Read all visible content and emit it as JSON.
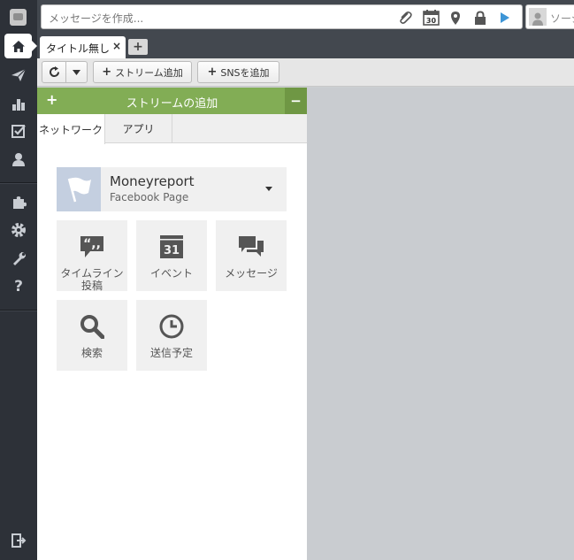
{
  "compose": {
    "placeholder": "メッセージを作成...",
    "calendar_day": "30",
    "icons": [
      "paperclip-icon",
      "calendar-icon",
      "location-pin-icon",
      "lock-icon",
      "send-arrow-icon"
    ]
  },
  "profile_selector": {
    "text": "ソーシ"
  },
  "sidebar": {
    "items": [
      {
        "name": "home-icon",
        "active": true
      },
      {
        "name": "send-icon"
      },
      {
        "name": "analytics-icon"
      },
      {
        "name": "assignments-icon"
      },
      {
        "name": "contacts-icon"
      },
      {
        "name": "apps-puzzle-icon"
      },
      {
        "name": "settings-gear-icon"
      },
      {
        "name": "tools-wrench-icon"
      },
      {
        "name": "help-icon"
      },
      {
        "name": "logout-icon"
      }
    ]
  },
  "tabs": {
    "current_label": "タイトル無し",
    "close_glyph": "×",
    "add_glyph": "+"
  },
  "toolbar": {
    "add_stream_label": "ストリーム追加",
    "add_sns_label": "SNSを追加"
  },
  "add_stream_panel": {
    "title": "ストリームの追加",
    "plus_glyph": "+",
    "minimize_glyph": "−",
    "tabs": [
      "ネットワーク",
      "アプリ"
    ],
    "account": {
      "name": "Moneyreport",
      "type": "Facebook Page"
    },
    "tiles": [
      {
        "label": "タイムライン投稿",
        "icon": "quote-bubble-icon"
      },
      {
        "label": "イベント",
        "icon": "calendar-31-icon",
        "calendar_day": "31"
      },
      {
        "label": "メッセージ",
        "icon": "chat-bubbles-icon"
      },
      {
        "label": "検索",
        "icon": "search-icon"
      },
      {
        "label": "送信予定",
        "icon": "clock-icon"
      }
    ]
  },
  "colors": {
    "sidebar_bg": "#2d3138",
    "topbar_bg": "#43484f",
    "panel_header": "#82ad55",
    "content_bg": "#c9ccd0"
  }
}
